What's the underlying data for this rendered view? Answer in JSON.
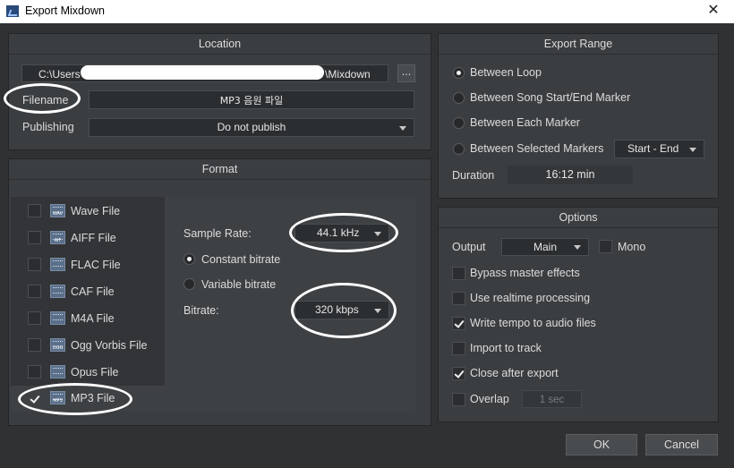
{
  "window": {
    "title": "Export Mixdown",
    "close_glyph": "✕"
  },
  "location": {
    "header": "Location",
    "path_prefix": "C:\\Users",
    "path_suffix": "\\Mixdown",
    "browse_label": "...",
    "filename_label": "Filename",
    "filename_value": "MP3 음원 파일",
    "publishing_label": "Publishing",
    "publishing_value": "Do not publish"
  },
  "format": {
    "header": "Format",
    "items": [
      {
        "label": "Wave File",
        "tag": "WAV",
        "checked": false
      },
      {
        "label": "AIFF File",
        "tag": "AIF",
        "checked": false
      },
      {
        "label": "FLAC File",
        "tag": "",
        "checked": false
      },
      {
        "label": "CAF File",
        "tag": "",
        "checked": false
      },
      {
        "label": "M4A File",
        "tag": "",
        "checked": false
      },
      {
        "label": "Ogg Vorbis File",
        "tag": "OGG",
        "checked": false
      },
      {
        "label": "Opus File",
        "tag": "",
        "checked": false
      },
      {
        "label": "MP3 File",
        "tag": "MP3",
        "checked": true
      }
    ],
    "sample_rate_label": "Sample Rate:",
    "sample_rate_value": "44.1 kHz",
    "constant_bitrate_label": "Constant bitrate",
    "variable_bitrate_label": "Variable bitrate",
    "bitrate_label": "Bitrate:",
    "bitrate_value": "320 kbps"
  },
  "export_range": {
    "header": "Export Range",
    "options": [
      {
        "label": "Between Loop",
        "selected": true
      },
      {
        "label": "Between Song Start/End Marker",
        "selected": false
      },
      {
        "label": "Between Each Marker",
        "selected": false
      },
      {
        "label": "Between Selected Markers",
        "selected": false
      }
    ],
    "markers_dropdown_value": "Start - End",
    "duration_label": "Duration",
    "duration_value": "16:12 min"
  },
  "options": {
    "header": "Options",
    "output_label": "Output",
    "output_value": "Main",
    "mono_label": "Mono",
    "mono_checked": false,
    "items": [
      {
        "label": "Bypass master effects",
        "checked": false
      },
      {
        "label": "Use realtime processing",
        "checked": false
      },
      {
        "label": "Write tempo to audio files",
        "checked": true
      },
      {
        "label": "Import to track",
        "checked": false
      },
      {
        "label": "Close after export",
        "checked": true
      },
      {
        "label": "Overlap",
        "checked": false
      }
    ],
    "overlap_value": "1 sec"
  },
  "buttons": {
    "ok": "OK",
    "cancel": "Cancel"
  },
  "colors": {
    "background": "#2f3133",
    "panel": "#3b3e41",
    "field": "#2b2e31",
    "annotation": "#ffffff"
  }
}
